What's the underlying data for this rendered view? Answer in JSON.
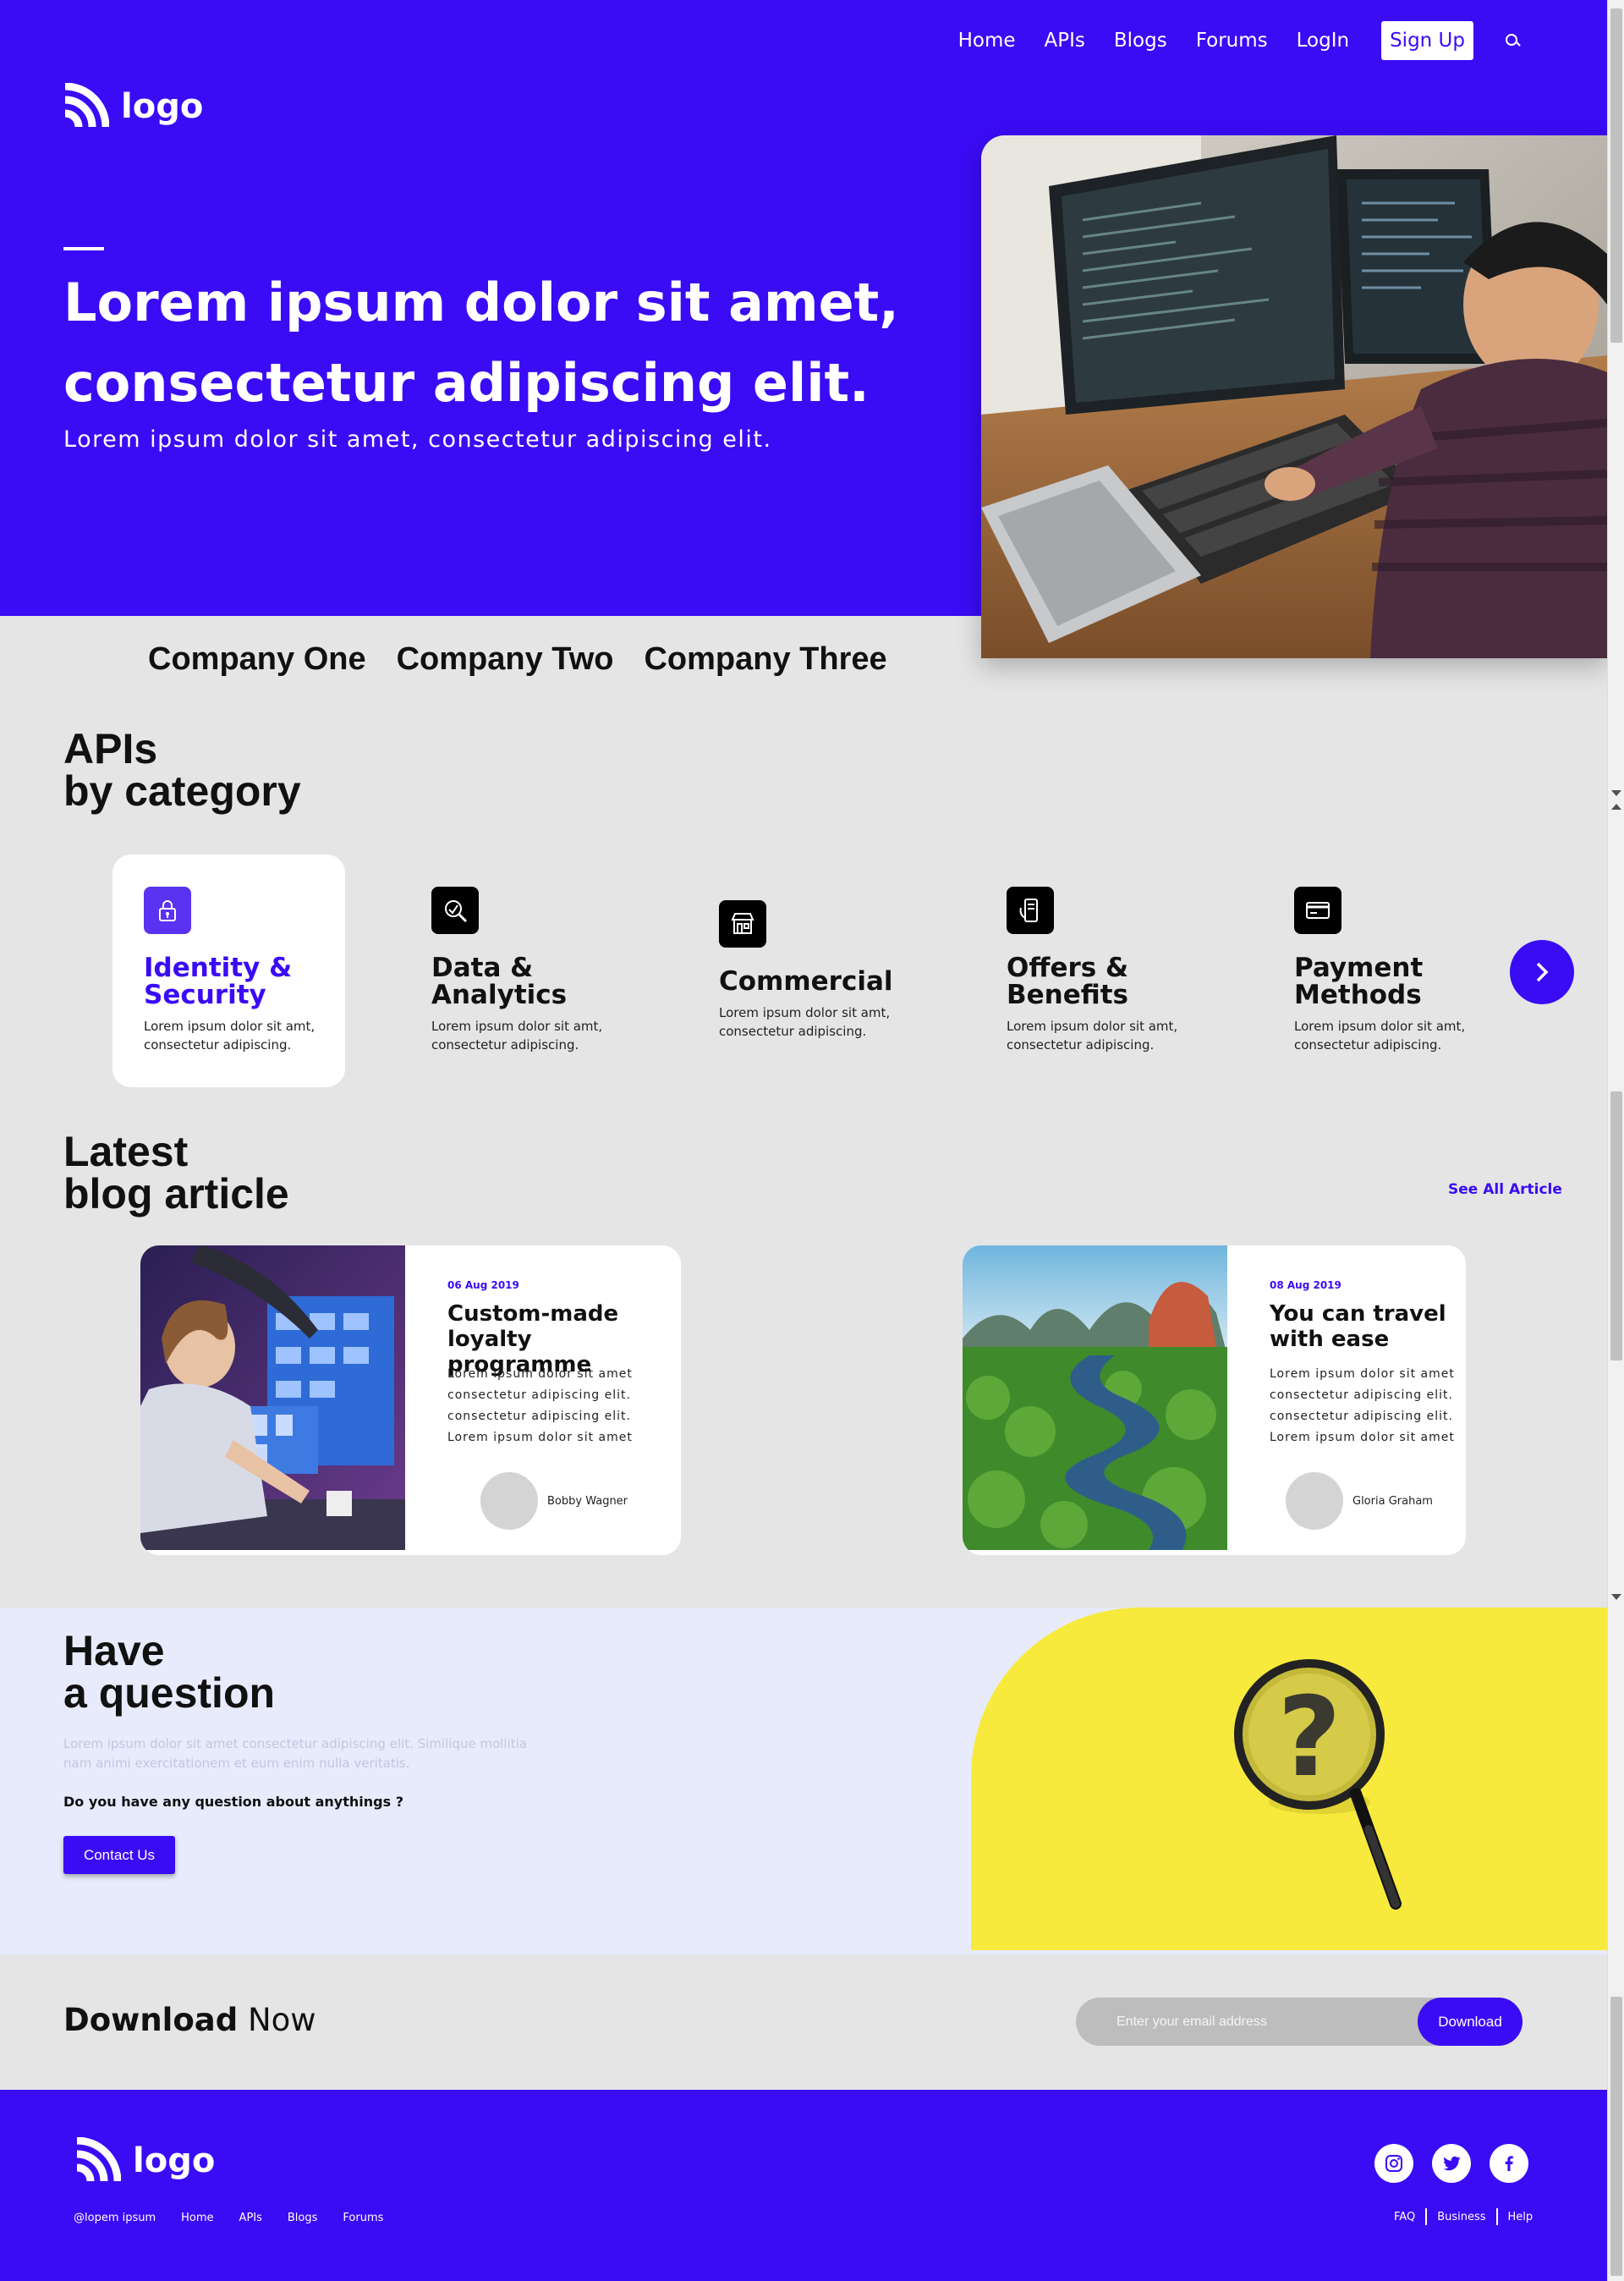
{
  "nav": {
    "items": [
      "Home",
      "APIs",
      "Blogs",
      "Forums",
      "LogIn"
    ],
    "signup": "Sign Up"
  },
  "brand": {
    "logo_text": "logo"
  },
  "hero": {
    "title": "Lorem ipsum dolor sit amet, consectetur adipiscing elit.",
    "subtitle": "Lorem ipsum dolor sit amet, consectetur adipiscing elit."
  },
  "companies": [
    "Company One",
    "Company Two",
    "Company Three"
  ],
  "apis": {
    "title_line1": "APIs",
    "title_line2": "by category",
    "categories": [
      {
        "name": "Identity & Security",
        "desc": "Lorem ipsum dolor sit amt, consectetur adipiscing.",
        "icon": "lock-icon",
        "active": true
      },
      {
        "name": "Data & Analytics",
        "desc": "Lorem ipsum dolor sit amt, consectetur adipiscing.",
        "icon": "analytics-icon",
        "active": false
      },
      {
        "name": "Commercial",
        "desc": "Lorem ipsum dolor sit amt, consectetur adipiscing.",
        "icon": "store-icon",
        "active": false
      },
      {
        "name": "Offers & Benefits",
        "desc": "Lorem ipsum dolor sit amt, consectetur adipiscing.",
        "icon": "receipt-icon",
        "active": false
      },
      {
        "name": "Payment Methods",
        "desc": "Lorem ipsum dolor sit amt, consectetur adipiscing.",
        "icon": "credit-card-icon",
        "active": false
      }
    ]
  },
  "blog": {
    "title_line1": "Latest",
    "title_line2": "blog article",
    "see_all": "See All Article",
    "posts": [
      {
        "date": "06 Aug 2019",
        "title": "Custom-made loyalty programme",
        "body": "Lorem ipsum dolor sit amet consectetur adipiscing elit. consectetur adipiscing elit. Lorem ipsum dolor sit amet",
        "author": "Bobby Wagner"
      },
      {
        "date": "08 Aug 2019",
        "title": "You can travel with ease",
        "body": "Lorem ipsum dolor sit amet consectetur adipiscing elit. consectetur adipiscing elit. Lorem ipsum dolor sit amet",
        "author": "Gloria Graham"
      }
    ]
  },
  "question": {
    "title_line1": "Have",
    "title_line2": "a question",
    "text": "Lorem ipsum dolor sit amet consectetur adipiscing elit. Similique mollitia nam animi exercitationem et eum enim nulla veritatis.",
    "ask": "Do you have any question about anythings ?",
    "button": "Contact Us"
  },
  "download": {
    "title_bold": "Download",
    "title_rest": "Now",
    "placeholder": "Enter your email address",
    "button": "Download"
  },
  "footer": {
    "logo_text": "logo",
    "links": [
      "@lopem ipsum",
      "Home",
      "APIs",
      "Blogs",
      "Forums"
    ],
    "right_links": [
      "FAQ",
      "Business",
      "Help"
    ],
    "social": [
      "instagram-icon",
      "twitter-icon",
      "facebook-icon"
    ]
  },
  "colors": {
    "brand": "#3a0bf5",
    "accent_yellow": "#f7ea3c",
    "page_bg": "#e5e5e5",
    "question_bg": "#e8ebfc"
  }
}
